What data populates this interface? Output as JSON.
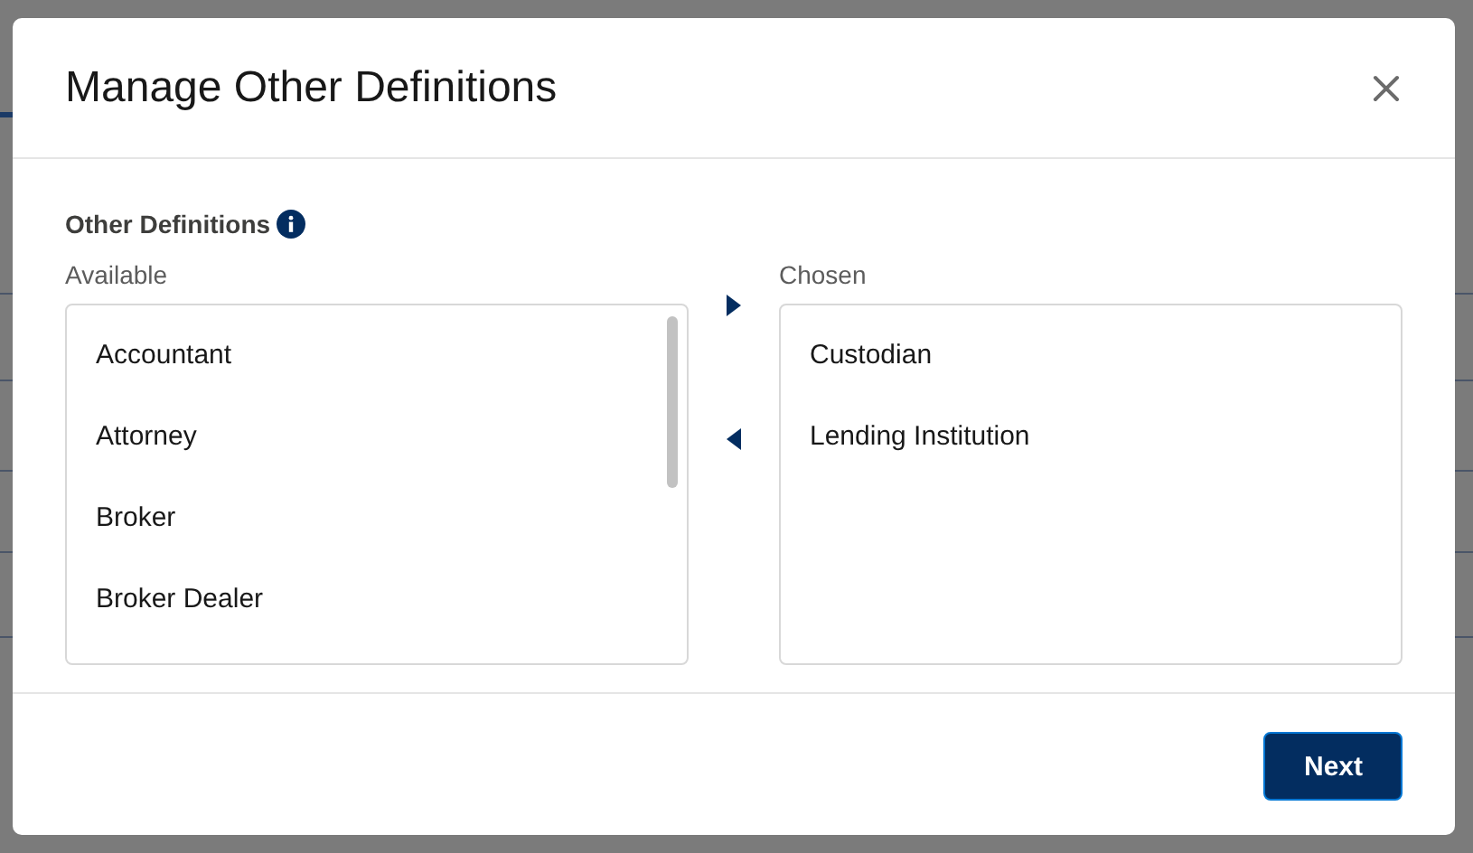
{
  "modal": {
    "title": "Manage Other Definitions",
    "field_label": "Other Definitions",
    "available": {
      "label": "Available",
      "items": [
        {
          "label": "Accountant",
          "selected": false
        },
        {
          "label": "Attorney",
          "selected": false
        },
        {
          "label": "Broker",
          "selected": false
        },
        {
          "label": "Broker Dealer",
          "selected": false
        }
      ]
    },
    "chosen": {
      "label": "Chosen",
      "items": [
        {
          "label": "Custodian",
          "selected": false
        },
        {
          "label": "Lending Institution",
          "selected": false
        }
      ]
    },
    "buttons": [
      {
        "label": "Next",
        "kind": "primary"
      }
    ]
  }
}
